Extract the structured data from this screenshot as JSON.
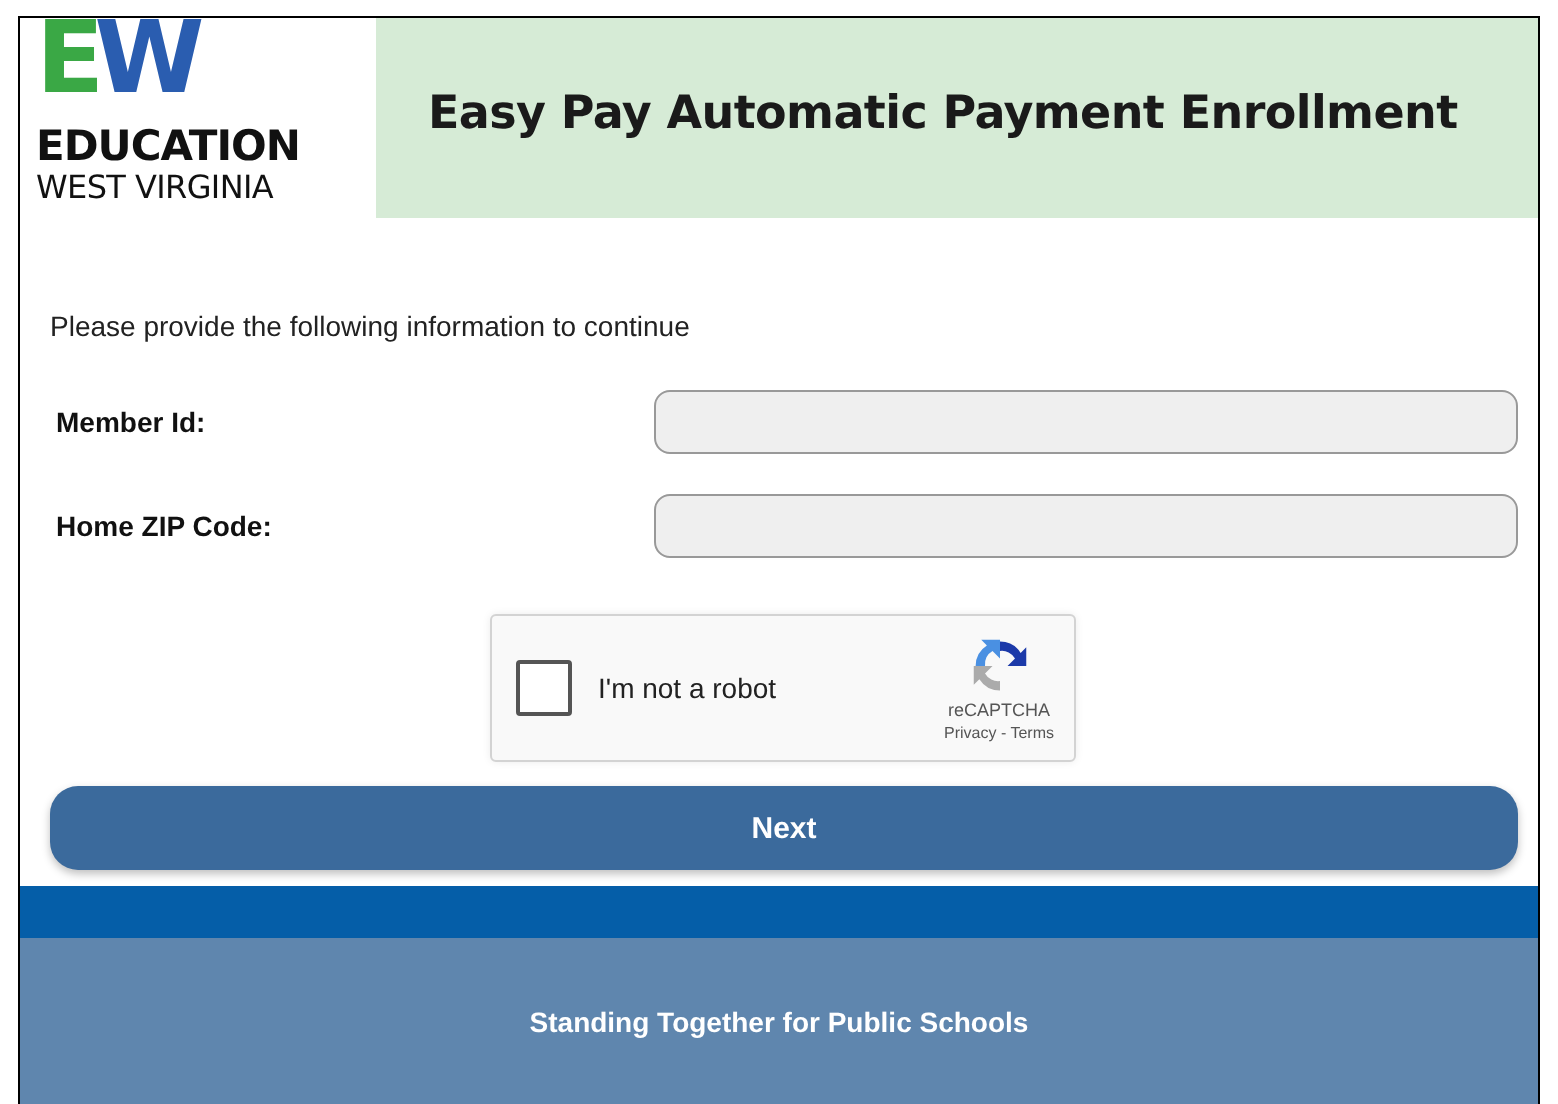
{
  "logo": {
    "letters": [
      "E",
      "W"
    ],
    "line1": "EDUCATION",
    "line2": "WEST VIRGINIA"
  },
  "title": "Easy Pay Automatic Payment Enrollment",
  "intro": "Please provide the following information to continue",
  "fields": [
    {
      "label": "Member Id:"
    },
    {
      "label": "Home ZIP Code:"
    }
  ],
  "captcha": {
    "label": "I'm not a robot",
    "checked": false,
    "brand": "reCAPTCHA",
    "privacy": "Privacy",
    "separator": "-",
    "terms": "Terms"
  },
  "button": "Next",
  "footer": "Standing Together for Public Schools"
}
